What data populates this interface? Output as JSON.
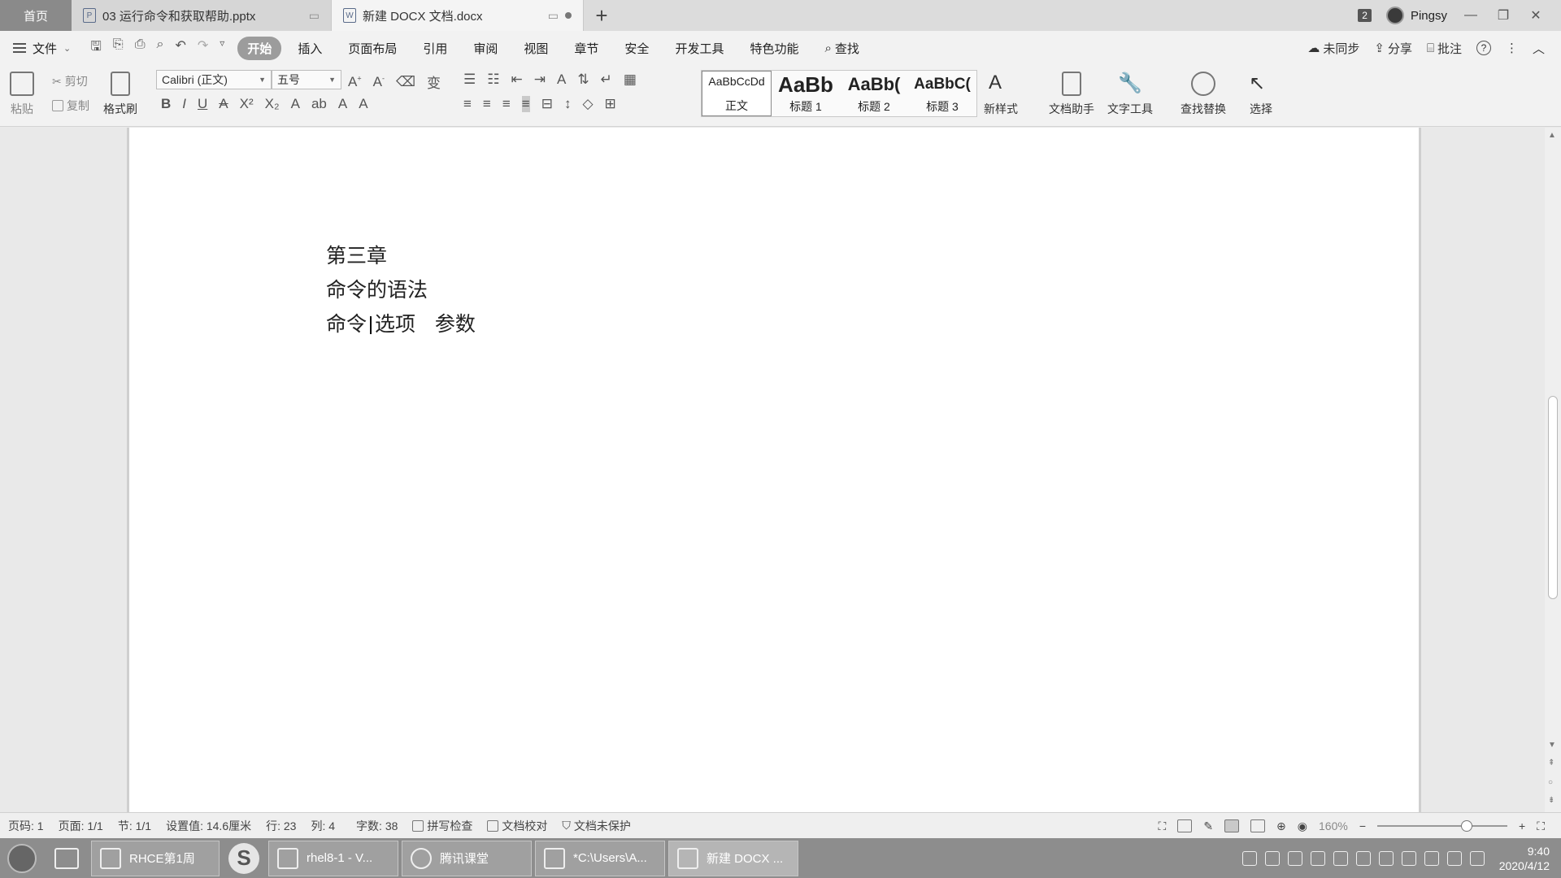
{
  "tabs": {
    "home": "首页",
    "items": [
      {
        "title": "03 运行命令和获取帮助.pptx",
        "icon": "pptx-icon"
      },
      {
        "title": "新建 DOCX 文档.docx",
        "icon": "docx-icon"
      }
    ],
    "add": "+",
    "window_count": "2",
    "user": "Pingsy"
  },
  "menu": {
    "file": "文件",
    "items": [
      "开始",
      "插入",
      "页面布局",
      "引用",
      "审阅",
      "视图",
      "章节",
      "安全",
      "开发工具",
      "特色功能"
    ],
    "active": "开始",
    "search": "查找",
    "right": {
      "sync": "未同步",
      "share": "分享",
      "comment": "批注",
      "help": "?"
    }
  },
  "ribbon": {
    "paste": "粘贴",
    "cut": "剪切",
    "copy": "复制",
    "format_painter": "格式刷",
    "font_name": "Calibri (正文)",
    "font_size": "五号",
    "styles": [
      {
        "preview": "AaBbCcDd",
        "name": "正文"
      },
      {
        "preview": "AaBb",
        "name": "标题 1"
      },
      {
        "preview": "AaBb(",
        "name": "标题 2"
      },
      {
        "preview": "AaBbC(",
        "name": "标题 3"
      }
    ],
    "new_style": "新样式",
    "doc_assistant": "文档助手",
    "text_tools": "文字工具",
    "find_replace": "查找替换",
    "select": "选择"
  },
  "document": {
    "lines": [
      "第三章",
      "命令的语法",
      "命令",
      "选项   参数"
    ]
  },
  "status": {
    "page_code": "页码: 1",
    "page": "页面: 1/1",
    "section": "节: 1/1",
    "setting": "设置值: 14.6厘米",
    "row": "行: 23",
    "col": "列: 4",
    "word_count": "字数: 38",
    "spell_check": "拼写检查",
    "doc_proof": "文档校对",
    "protect": "文档未保护",
    "zoom": "160%",
    "zoom_level_percent": 160
  },
  "taskbar": {
    "apps": [
      {
        "label": "RHCE第1周"
      },
      {
        "label": "rhel8-1 - V..."
      },
      {
        "label": "腾讯课堂"
      },
      {
        "label": "*C:\\Users\\A..."
      },
      {
        "label": "新建 DOCX ..."
      }
    ],
    "time": "9:40",
    "date": "2020/4/12"
  }
}
